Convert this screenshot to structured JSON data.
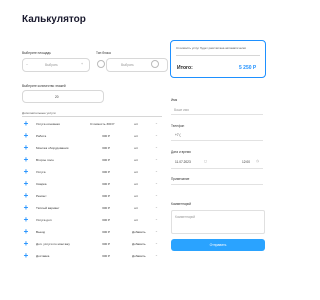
{
  "app": {
    "title": "Калькулятор"
  },
  "top": {
    "area_label": "Выберите площадь",
    "type_label": "Тип блока",
    "area_value": "Выбрать",
    "type_value": "Выбрать"
  },
  "count": {
    "label": "Выберите количество этажей",
    "value": "20"
  },
  "total": {
    "note": "Стоимость услуг будет рассчитана автоматически",
    "label": "Итого:",
    "value": "5 250 Р"
  },
  "list": {
    "header": "Дополнительные услуги",
    "items": [
      {
        "name": "Услуга основная",
        "price": "Стоимость 300 Р",
        "unit": "шт"
      },
      {
        "name": "Работа",
        "price": "300 Р",
        "unit": "шт"
      },
      {
        "name": "Монтаж оборудования",
        "price": "300 Р",
        "unit": "шт"
      },
      {
        "name": "Второе поле",
        "price": "300 Р",
        "unit": "шт"
      },
      {
        "name": "Услуга",
        "price": "300 Р",
        "unit": "шт"
      },
      {
        "name": "Сварка",
        "price": "300 Р",
        "unit": "шт"
      },
      {
        "name": "Ремонт",
        "price": "300 Р",
        "unit": "шт"
      },
      {
        "name": "Тёплый вариант",
        "price": "300 Р",
        "unit": "шт"
      },
      {
        "name": "Услуга доп",
        "price": "300 Р",
        "unit": "шт"
      },
      {
        "name": "Выезд",
        "price": "300 Р",
        "unit": "Добавить"
      },
      {
        "name": "Доп. услуги по монтажу",
        "price": "300 Р",
        "unit": "Добавить"
      },
      {
        "name": "Доставка",
        "price": "300 Р",
        "unit": "Добавить"
      }
    ]
  },
  "form": {
    "name_label": "Имя",
    "name_placeholder": "Ваше имя",
    "phone_label": "Телефон",
    "phone_value": "+7 (",
    "date_label": "Дата и время",
    "date_value": "11.07.2023",
    "time_value": "12:00",
    "extra_label": "Примечание",
    "comment_label": "Комментарий",
    "comment_placeholder": "Комментарий",
    "submit_label": "Отправить"
  },
  "colors": {
    "accent": "#1e90ff",
    "button": "#2aa3ff"
  }
}
